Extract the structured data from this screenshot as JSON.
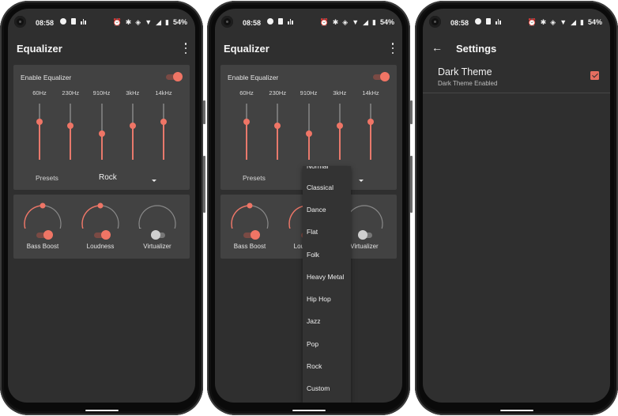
{
  "status_bar": {
    "time": "08:58",
    "battery": "54%",
    "left_icons": [
      "notification-dot-icon",
      "sim-card-icon",
      "signal-bars-icon"
    ],
    "right_icons": [
      "alarm-icon",
      "bluetooth-icon",
      "vibrate-icon",
      "wifi-icon",
      "cell-signal-icon",
      "battery-icon"
    ]
  },
  "colors": {
    "accent": "#ef7566",
    "background": "#2f2f2f",
    "card": "#424242"
  },
  "equalizer_screen": {
    "title": "Equalizer",
    "menu_icon": "more-vert-icon",
    "enable_label": "Enable Equalizer",
    "enabled": true,
    "bands": [
      {
        "label": "60Hz",
        "level": 0.67
      },
      {
        "label": "230Hz",
        "level": 0.6
      },
      {
        "label": "910Hz",
        "level": 0.46
      },
      {
        "label": "3kHz",
        "level": 0.6
      },
      {
        "label": "14kHz",
        "level": 0.67
      }
    ],
    "presets_label": "Presets",
    "preset_value": "Rock",
    "effects": [
      {
        "label": "Bass Boost",
        "enabled": true,
        "level": 0.5
      },
      {
        "label": "Loudness",
        "enabled": true,
        "level": 0.5
      },
      {
        "label": "Virtualizer",
        "enabled": false,
        "level": 0.0
      }
    ]
  },
  "preset_dropdown": {
    "options": [
      "Normal",
      "Classical",
      "Dance",
      "Flat",
      "Folk",
      "Heavy Metal",
      "Hip Hop",
      "Jazz",
      "Pop",
      "Rock",
      "Custom"
    ]
  },
  "settings_screen": {
    "title": "Settings",
    "back_icon": "arrow-back-icon",
    "preferences": [
      {
        "title": "Dark Theme",
        "summary": "Dark Theme Enabled",
        "checked": true
      }
    ]
  }
}
